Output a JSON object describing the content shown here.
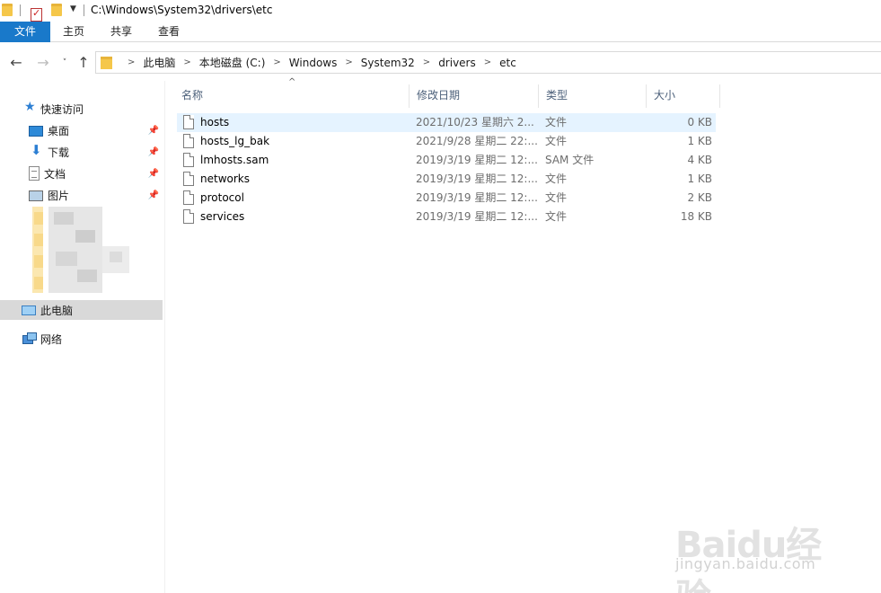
{
  "title_bar": {
    "path": "C:\\Windows\\System32\\drivers\\etc"
  },
  "ribbon": {
    "tabs": [
      {
        "label": "文件",
        "active": true
      },
      {
        "label": "主页"
      },
      {
        "label": "共享"
      },
      {
        "label": "查看"
      }
    ],
    "accent_color": "#1979ca"
  },
  "address": {
    "breadcrumbs": [
      "此电脑",
      "本地磁盘 (C:)",
      "Windows",
      "System32",
      "drivers",
      "etc"
    ]
  },
  "nav_pane": {
    "quick_access_label": "快速访问",
    "quick_items": [
      {
        "label": "桌面",
        "icon": "desktop-icon"
      },
      {
        "label": "下载",
        "icon": "download-icon"
      },
      {
        "label": "文档",
        "icon": "documents-icon"
      },
      {
        "label": "图片",
        "icon": "pictures-icon"
      }
    ],
    "this_pc_label": "此电脑",
    "network_label": "网络"
  },
  "file_list": {
    "columns": {
      "name": "名称",
      "date": "修改日期",
      "type": "类型",
      "size": "大小"
    },
    "rows": [
      {
        "name": "hosts",
        "date": "2021/10/23 星期六 2...",
        "type": "文件",
        "size": "0 KB",
        "selected": true
      },
      {
        "name": "hosts_lg_bak",
        "date": "2021/9/28 星期二 22:...",
        "type": "文件",
        "size": "1 KB"
      },
      {
        "name": "lmhosts.sam",
        "date": "2019/3/19 星期二 12:...",
        "type": "SAM 文件",
        "size": "4 KB"
      },
      {
        "name": "networks",
        "date": "2019/3/19 星期二 12:...",
        "type": "文件",
        "size": "1 KB"
      },
      {
        "name": "protocol",
        "date": "2019/3/19 星期二 12:...",
        "type": "文件",
        "size": "2 KB"
      },
      {
        "name": "services",
        "date": "2019/3/19 星期二 12:...",
        "type": "文件",
        "size": "18 KB"
      }
    ]
  },
  "watermark": {
    "brand": "Baidu经验",
    "url": "jingyan.baidu.com"
  }
}
